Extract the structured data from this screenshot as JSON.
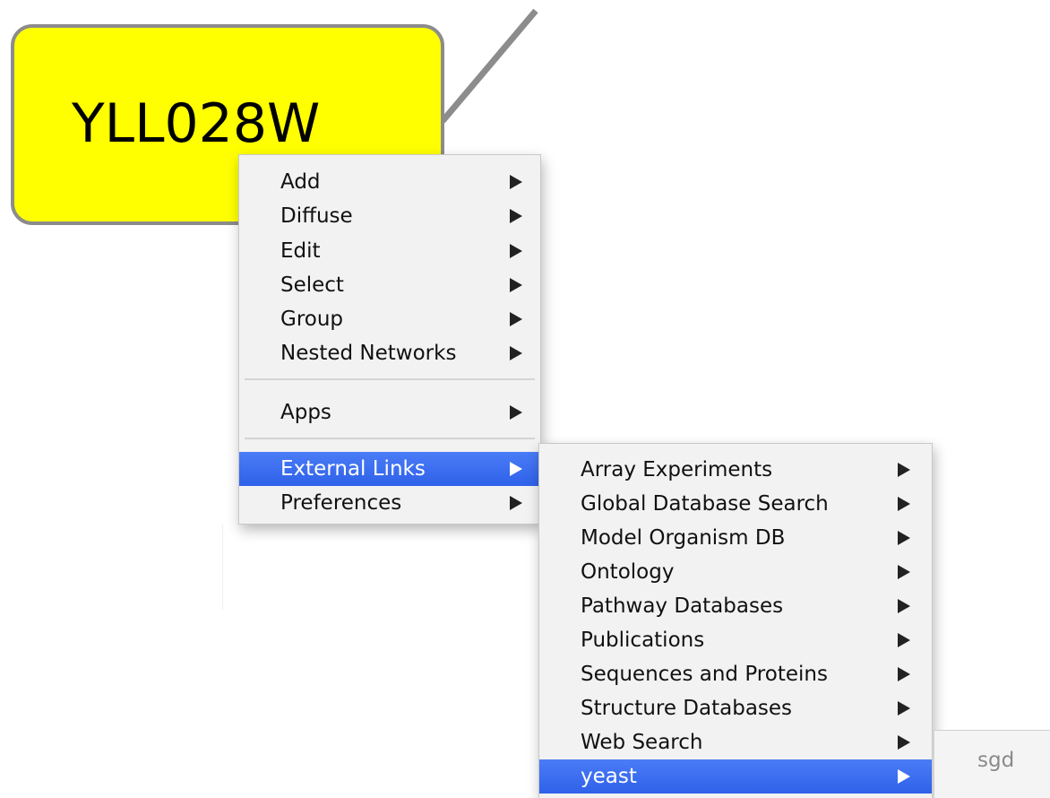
{
  "node": {
    "label": "YLL028W",
    "fill_color": "#ffff00",
    "border_color": "#8c8c8c"
  },
  "context_menu": {
    "items": [
      {
        "label": "Add",
        "submenu": true
      },
      {
        "label": "Diffuse",
        "submenu": true
      },
      {
        "label": "Edit",
        "submenu": true
      },
      {
        "label": "Select",
        "submenu": true
      },
      {
        "label": "Group",
        "submenu": true
      },
      {
        "label": "Nested Networks",
        "submenu": true
      },
      {
        "label": "Apps",
        "submenu": true
      },
      {
        "label": "External Links",
        "submenu": true,
        "selected": true
      },
      {
        "label": "Preferences",
        "submenu": true
      }
    ]
  },
  "external_links_menu": {
    "items": [
      {
        "label": "Array Experiments",
        "submenu": true
      },
      {
        "label": "Global Database Search",
        "submenu": true
      },
      {
        "label": "Model Organism DB",
        "submenu": true
      },
      {
        "label": "Ontology",
        "submenu": true
      },
      {
        "label": "Pathway Databases",
        "submenu": true
      },
      {
        "label": "Publications",
        "submenu": true
      },
      {
        "label": "Sequences and Proteins",
        "submenu": true
      },
      {
        "label": "Structure Databases",
        "submenu": true
      },
      {
        "label": "Web Search",
        "submenu": true
      },
      {
        "label": "yeast",
        "submenu": true,
        "selected": true
      }
    ]
  },
  "yeast_menu": {
    "items": [
      {
        "label": "sgd"
      }
    ]
  },
  "colors": {
    "selection": "#3d6ff2",
    "menu_background": "#f2f2f2",
    "edge": "#8c8c8c"
  }
}
